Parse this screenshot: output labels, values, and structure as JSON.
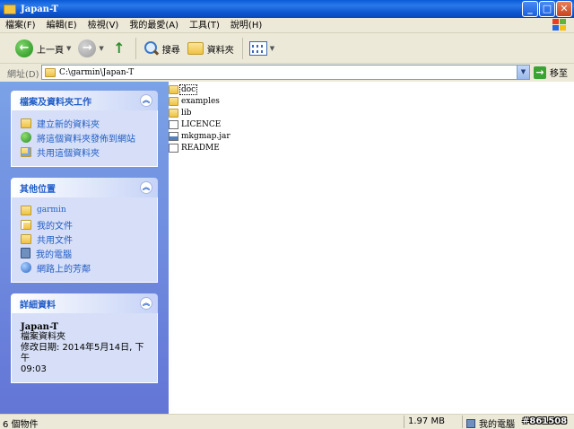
{
  "window": {
    "title": "Japan-T"
  },
  "menu": [
    "檔案(F)",
    "編輯(E)",
    "檢視(V)",
    "我的最愛(A)",
    "工具(T)",
    "說明(H)"
  ],
  "toolbar": {
    "back_label": "上一頁",
    "search_label": "搜尋",
    "folders_label": "資料夾"
  },
  "address": {
    "label": "網址(D)",
    "value": "C:\\garmin\\Japan-T",
    "go_label": "移至"
  },
  "tasks_panel": {
    "title": "檔案及資料夾工作",
    "items": [
      "建立新的資料夾",
      "將這個資料夾發佈到網站",
      "共用這個資料夾"
    ]
  },
  "places_panel": {
    "title": "其他位置",
    "items": [
      "garmin",
      "我的文件",
      "共用文件",
      "我的電腦",
      "網路上的芳鄰"
    ]
  },
  "details_panel": {
    "title": "詳細資料",
    "name": "Japan-T",
    "type": "檔案資料夾",
    "modified": "修改日期: 2014年5月14日, 下午",
    "modified_time": "09:03"
  },
  "files": [
    "doc",
    "examples",
    "lib",
    "LICENCE",
    "mkgmap.jar",
    "README"
  ],
  "status": {
    "count": "6 個物件",
    "size": "1.97 MB",
    "location": "我的電腦",
    "watermark": "#861508"
  },
  "icons": {
    "back": "back-arrow-icon",
    "forward": "forward-arrow-icon",
    "up": "up-folder-icon",
    "search": "search-icon",
    "folders": "folders-icon",
    "views": "views-icon",
    "go": "go-arrow-icon"
  },
  "colors": {
    "taskpane_top": "#7ba2e7",
    "taskpane_bottom": "#6375d6",
    "link": "#215dc6",
    "titlebar": "#0a5ad6"
  }
}
